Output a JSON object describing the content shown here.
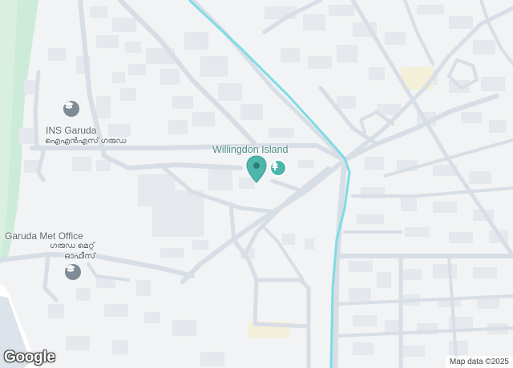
{
  "map": {
    "labels": {
      "ins_garuda": {
        "en": "INS Garuda",
        "ml": "ഐഎൻഎസ് ഗരുഡ"
      },
      "met_office": {
        "en": "Garuda Met Office",
        "ml_line1": "ഗരുഡ മെറ്റ്",
        "ml_line2": "ഓഫീസ്"
      },
      "place": "Willingdon Island"
    },
    "attribution": "Map data ©2025",
    "logo": "Google",
    "colors": {
      "land": "#f1f3f4",
      "road": "#d8dee6",
      "building": "#e5e8ec",
      "park": "#cdebd9",
      "water": "#7fdbe3",
      "pin": "#4db6ac",
      "poi_gray": "#7e8a96"
    }
  }
}
